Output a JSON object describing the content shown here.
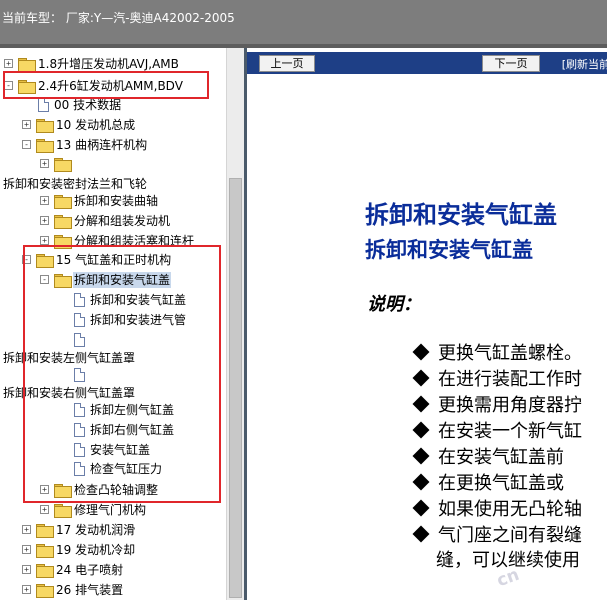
{
  "header": {
    "vehicle_label": "当前车型：  厂家:Y—汽-奥迪A42002-2005"
  },
  "tree": {
    "items": [
      {
        "label": "1.8升增压发动机AVJ,AMB",
        "icon": "folder-icon",
        "expander": "+"
      },
      {
        "label": "2.4升6缸发动机AMM,BDV",
        "icon": "folder-icon",
        "expander": "-"
      },
      {
        "label": "00 技术数据",
        "icon": "document-icon"
      },
      {
        "label": "10 发动机总成",
        "icon": "folder-icon",
        "expander": "+"
      },
      {
        "label": "13 曲柄连杆机构",
        "icon": "folder-icon",
        "expander": "-"
      },
      {
        "label": "",
        "icon": "folder-icon",
        "expander": "+"
      },
      {
        "label": "拆卸和安装密封法兰和飞轮",
        "icon": ""
      },
      {
        "label": "拆卸和安装曲轴",
        "icon": "folder-icon",
        "expander": "+"
      },
      {
        "label": "分解和组装发动机",
        "icon": "folder-icon",
        "expander": "+"
      },
      {
        "label": "分解和组装活塞和连杆",
        "icon": "folder-icon",
        "expander": "+"
      },
      {
        "label": "15 气缸盖和正时机构",
        "icon": "folder-icon",
        "expander": "-"
      },
      {
        "label": "拆卸和安装气缸盖",
        "icon": "folder-icon",
        "expander": "-",
        "selected": true
      },
      {
        "label": "拆卸和安装气缸盖",
        "icon": "document-icon"
      },
      {
        "label": "拆卸和安装进气管",
        "icon": "document-icon"
      },
      {
        "label": "",
        "icon": "document-icon"
      },
      {
        "label": "拆卸和安装左侧气缸盖罩",
        "icon": ""
      },
      {
        "label": "",
        "icon": "document-icon"
      },
      {
        "label": "拆卸和安装右侧气缸盖罩",
        "icon": ""
      },
      {
        "label": "拆卸左侧气缸盖",
        "icon": "document-icon"
      },
      {
        "label": "拆卸右侧气缸盖",
        "icon": "document-icon"
      },
      {
        "label": "安装气缸盖",
        "icon": "document-icon"
      },
      {
        "label": "检查气缸压力",
        "icon": "document-icon"
      },
      {
        "label": "检查凸轮轴调整",
        "icon": "folder-icon",
        "expander": "+"
      },
      {
        "label": "修理气门机构",
        "icon": "folder-icon",
        "expander": "+"
      },
      {
        "label": "17 发动机润滑",
        "icon": "folder-icon",
        "expander": "+"
      },
      {
        "label": "19 发动机冷却",
        "icon": "folder-icon",
        "expander": "+"
      },
      {
        "label": "24 电子喷射",
        "icon": "folder-icon",
        "expander": "+"
      },
      {
        "label": "26 排气装置",
        "icon": "folder-icon",
        "expander": "+"
      }
    ]
  },
  "toolbar": {
    "prev_label": "上一页",
    "next_label": "下一页",
    "refresh_label": "[刷新当前"
  },
  "content": {
    "title_main": "拆卸和安装气缸盖",
    "title_sub": "拆卸和安装气缸盖",
    "note_label": "说明：",
    "bullets": [
      "更换气缸盖螺栓。",
      "在进行装配工作时",
      "更换需用角度器拧",
      "在安装一个新气缸",
      "在安装气缸盖前",
      "在更换气缸盖或",
      "如果使用无凸轮轴",
      "气门座之间有裂缝"
    ],
    "continuation": "缝，可以继续使用"
  },
  "watermark": "cn",
  "colors": {
    "header_bg": "#7d7d7d",
    "nav_bg": "#1e3f86",
    "title_color": "#0a2d9a",
    "annotation_red": "#e0262b",
    "selection_bg": "#c8d8ec"
  }
}
